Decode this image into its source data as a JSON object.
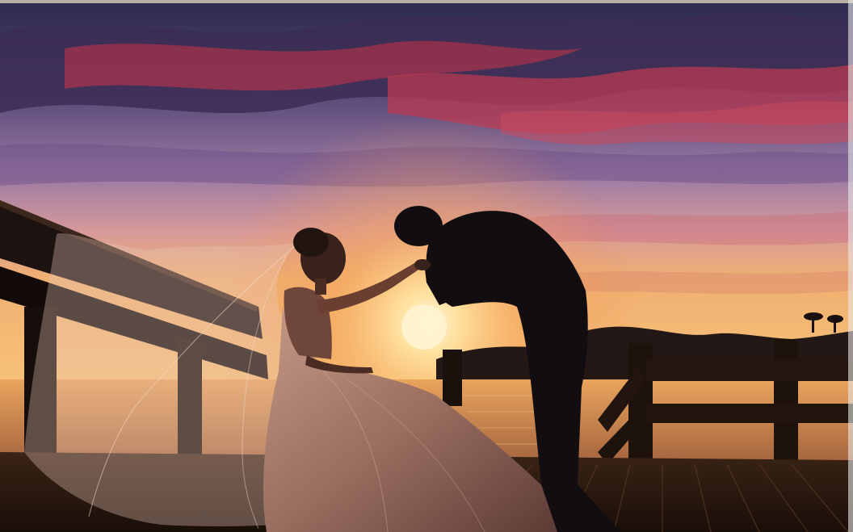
{
  "photo": {
    "subject": "wedding-couple-at-sunset",
    "colors": {
      "sky_top": "#2e2a4e",
      "sky_mid": "#8a6a9c",
      "sky_glow": "#f2a35a",
      "sun": "#fff2c8",
      "cloud_red": "#c2304a",
      "water": "#d9934f",
      "silhouette": "#120d10",
      "deck": "#2a1810",
      "veil": "#e8c6b8"
    }
  }
}
